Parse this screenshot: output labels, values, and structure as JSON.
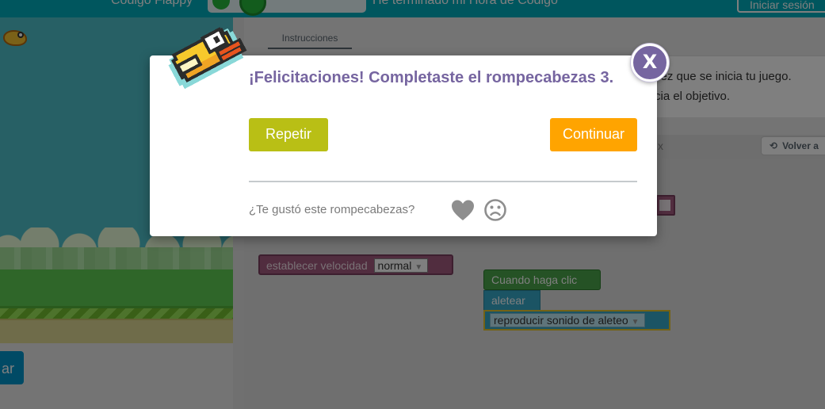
{
  "header": {
    "title_partial": "Código Flappy",
    "progress_message_partial": "He terminado mi Hora de Código",
    "signin_partial": "Iniciar sesión"
  },
  "run_button": {
    "label_partial": "ar"
  },
  "instructions": {
    "tab_label": "Instrucciones",
    "line1_partial": "vez que se inicia tu juego.",
    "line2_partial": "cia el objetivo."
  },
  "workspace": {
    "header_close_partial": "x",
    "reset_label_partial": "Volver a",
    "blocks": {
      "set_speed_label": "establecer velocidad",
      "set_speed_value": "normal",
      "when_click": "Cuando haga clic",
      "flap": "aletear",
      "play_sound": "reproducir sonido de aleteo"
    }
  },
  "dialog": {
    "title": "¡Felicitaciones! Completaste el rompecabezas 3.",
    "replay_button": "Repetir",
    "continue_button": "Continuar",
    "feedback_question": "¿Te gustó este rompecabezas?",
    "close_label": "X",
    "colors": {
      "title": "#7665a0",
      "replay": "#b9bf15",
      "continue": "#ffa400",
      "close": "#7665a0"
    },
    "icons": [
      "flappy-bird-icon",
      "heart-icon",
      "sad-face-icon",
      "close-icon"
    ]
  }
}
